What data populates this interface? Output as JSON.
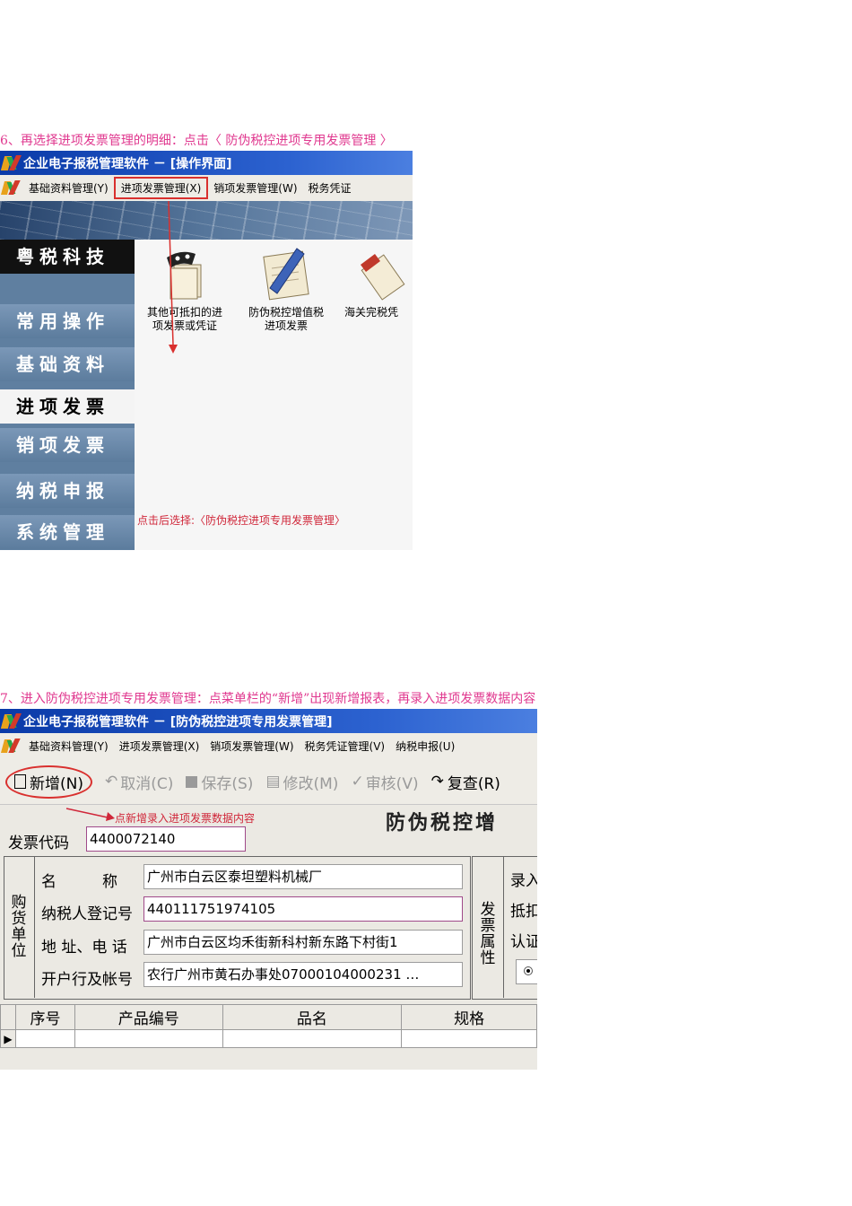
{
  "step6": {
    "text": "6、再选择进项发票管理的明细：点击〈 防伪税控进项专用发票管理 〉"
  },
  "shot1": {
    "title": "企业电子报税管理软件 － [操作界面]",
    "menu": [
      "基础资料管理(Y)",
      "进项发票管理(X)",
      "销项发票管理(W)",
      "税务凭证"
    ],
    "sidebar": [
      "粤税科技",
      "常用操作",
      "基础资料",
      "进项发票",
      "销项发票",
      "纳税申报",
      "系统管理"
    ],
    "icons": [
      {
        "label_line1": "其他可抵扣的进",
        "label_line2": "项发票或凭证"
      },
      {
        "label_line1": "防伪税控增值税",
        "label_line2": "进项发票"
      },
      {
        "label_line1": "海关完税凭",
        "label_line2": ""
      }
    ],
    "hint": "点击后选择:〈防伪税控进项专用发票管理〉"
  },
  "step7": {
    "text": "7、进入防伪税控进项专用发票管理：点菜单栏的“新增”出现新增报表，再录入进项发票数据内容"
  },
  "shot2": {
    "title": "企业电子报税管理软件 － [防伪税控进项专用发票管理]",
    "menu": [
      "基础资料管理(Y)",
      "进项发票管理(X)",
      "销项发票管理(W)",
      "税务凭证管理(V)",
      "纳税申报(U)"
    ],
    "toolbar": [
      "新增(N)",
      "取消(C)",
      "保存(S)",
      "修改(M)",
      "审核(V)",
      "复查(R)"
    ],
    "hint": "点新增录入进项发票数据内容",
    "form_title": "防伪税控增",
    "invoice_code_label": "发票代码",
    "invoice_code": "4400072140",
    "buyer_group": "购货单位",
    "fields": [
      {
        "label": "名　　　称",
        "value": "广州市白云区泰坦塑料机械厂"
      },
      {
        "label": "纳税人登记号",
        "value": "440111751974105"
      },
      {
        "label": "地 址、电 话",
        "value": "广州市白云区均禾街新科村新东路下村街1"
      },
      {
        "label": "开户行及帐号",
        "value": "农行广州市黄石办事处07000104000231 …"
      }
    ],
    "invoice_attr_group": "发票属性",
    "right_labels": [
      "录入",
      "抵扣",
      "认证"
    ],
    "grid_headers": [
      "序号",
      "产品编号",
      "品名",
      "规格"
    ]
  },
  "colors": {
    "step_text": "#e0388f",
    "accent_red": "#d0273a",
    "title_blue": "#0a3aa8"
  }
}
